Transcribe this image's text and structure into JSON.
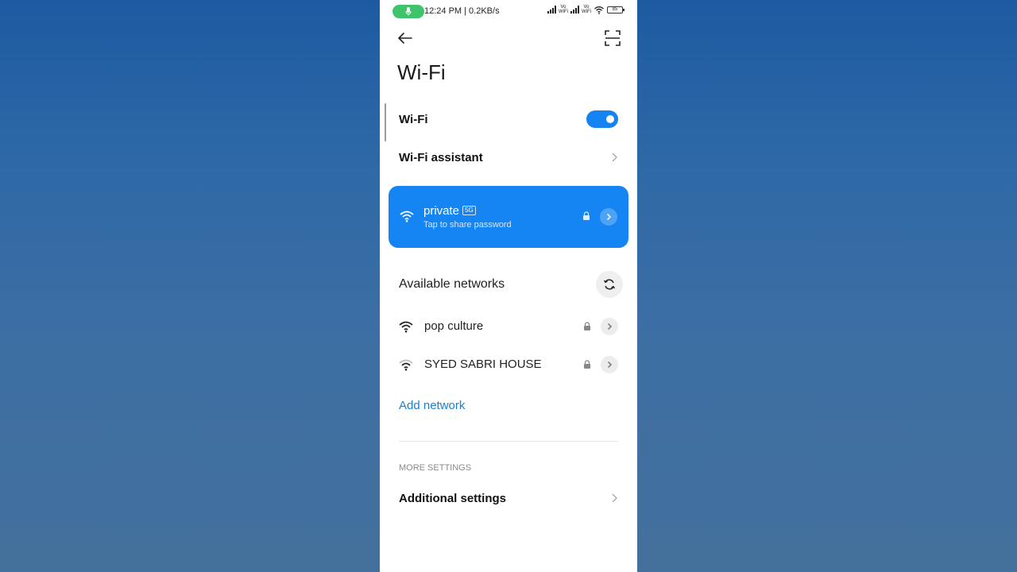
{
  "status_bar": {
    "time_speed": "12:24 PM | 0.2KB/s",
    "vowifi_1": "Vo WiFi",
    "vowifi_2": "Vo WiFi",
    "battery": "85",
    "mic_color": "#3fc46b"
  },
  "header": {
    "title": "Wi-Fi",
    "back_icon": "arrow-left-icon",
    "scan_icon": "qr-scan-icon"
  },
  "wifi_toggle": {
    "label": "Wi-Fi",
    "enabled": true,
    "accent": "#1683f2"
  },
  "wifi_assistant": {
    "label": "Wi-Fi assistant"
  },
  "connected_network": {
    "name": "private",
    "band": "5G",
    "subtitle": "Tap to share password",
    "secured": true,
    "card_color": "#1585f3"
  },
  "available": {
    "title": "Available networks",
    "networks": [
      {
        "name": "pop culture",
        "secured": true
      },
      {
        "name": "SYED SABRI HOUSE",
        "secured": true
      }
    ]
  },
  "add_network": {
    "label": "Add network",
    "color": "#1781d3"
  },
  "more_settings": {
    "section_label": "MORE SETTINGS",
    "additional_settings": "Additional settings"
  }
}
